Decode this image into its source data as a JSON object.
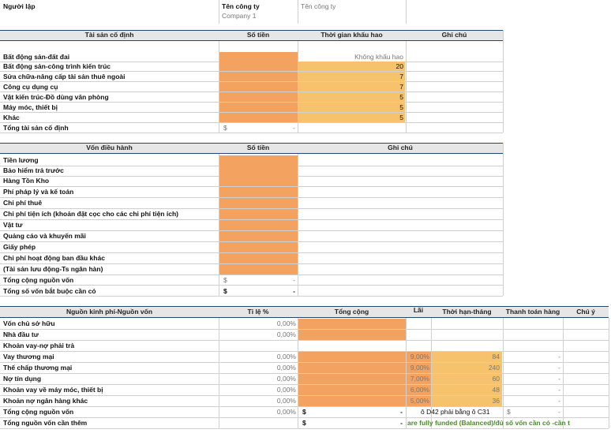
{
  "header": {
    "creator_label": "Người lập",
    "company_label": "Tên công ty",
    "company_placeholder": "Tên công ty",
    "company_value": "Company 1"
  },
  "fixed_assets": {
    "headers": [
      "Tài sản cố định",
      "Số tiền",
      "Thời gian khấu hao",
      "Ghi chú"
    ],
    "rows": [
      {
        "label": "Bất động sản-đất đai",
        "dep": "Không khấu hao"
      },
      {
        "label": "Bất động sản-công trình kiến trúc",
        "dep": "20"
      },
      {
        "label": "Sửa chữa-nâng cấp tài sản thuê ngoài",
        "dep": "7"
      },
      {
        "label": "Công cụ dụng cụ",
        "dep": "7"
      },
      {
        "label": "Vật kiến trúc-Đồ dùng văn phòng",
        "dep": "5"
      },
      {
        "label": "Máy móc, thiết bị",
        "dep": "5"
      },
      {
        "label": "Khác",
        "dep": "5"
      }
    ],
    "total_label": "Tổng tài sản cố định",
    "total_currency": "$",
    "total_value": "-"
  },
  "working_capital": {
    "headers": [
      "Vốn điều hành",
      "Số tiền",
      "Ghi chú"
    ],
    "rows": [
      "Tiền lương",
      "Bảo hiểm trả trước",
      "Hàng Tồn Kho",
      "Phí pháp lý và kế toán",
      "Chi phí thuê",
      "Chi phí tiện ích (khoản đặt cọc cho các chi phí tiện ích)",
      "Vật tư",
      "Quảng cáo và khuyến mãi",
      "Giấy phép",
      "Chi phí hoạt động ban đầu khác",
      "(Tài sản lưu động-Ts ngân hàn)"
    ],
    "total_label": "Tổng cộng nguồn vốn",
    "required_label": "Tổng số vốn bắt buộc cần có",
    "currency": "$",
    "dash": "-"
  },
  "funding": {
    "headers": [
      "Nguồn kinh phí-Nguồn vốn",
      "Tỉ lệ %",
      "Tổng cộng",
      "Lãi",
      "Thời hạn-tháng",
      "Thanh toán hàng",
      "Chú ý"
    ],
    "rows": [
      {
        "label": "Vốn chủ sở hữu",
        "pct": "0,00%",
        "rate": "",
        "term": "",
        "pay": "",
        "kind": "equity"
      },
      {
        "label": "Nhà đầu tư",
        "pct": "0,00%",
        "rate": "",
        "term": "",
        "pay": "",
        "kind": "equity"
      },
      {
        "label": "Khoản vay-nợ phải trả",
        "pct": "",
        "rate": "",
        "term": "",
        "pay": "",
        "kind": "section"
      },
      {
        "label": "Vay thương mại",
        "pct": "0,00%",
        "rate": "9,00%",
        "term": "84",
        "pay": "-",
        "kind": "loan"
      },
      {
        "label": "Thế chấp thương mại",
        "pct": "0,00%",
        "rate": "9,00%",
        "term": "240",
        "pay": "-",
        "kind": "loan"
      },
      {
        "label": "Nợ tín dụng",
        "pct": "0,00%",
        "rate": "7,00%",
        "term": "60",
        "pay": "-",
        "kind": "loan"
      },
      {
        "label": "Khoản vay về máy móc, thiết bị",
        "pct": "0,00%",
        "rate": "6,00%",
        "term": "48",
        "pay": "-",
        "kind": "loan"
      },
      {
        "label": "Khoản nợ ngân hàng khác",
        "pct": "0,00%",
        "rate": "5,00%",
        "term": "36",
        "pay": "-",
        "kind": "loan"
      }
    ],
    "total_label": "Tổng cộng nguồn vốn",
    "total_pct": "0,00%",
    "total_currency": "$",
    "total_value": "-",
    "check_text": "ô D42 phải bằng ô C31",
    "check_currency": "$",
    "check_value": "-",
    "needed_label": "Tổng nguồn vốn cần thêm",
    "needed_currency": "$",
    "needed_value": "-",
    "status_text": "are fully funded (Balanced)/đủ số vốn cần có -cần t"
  }
}
